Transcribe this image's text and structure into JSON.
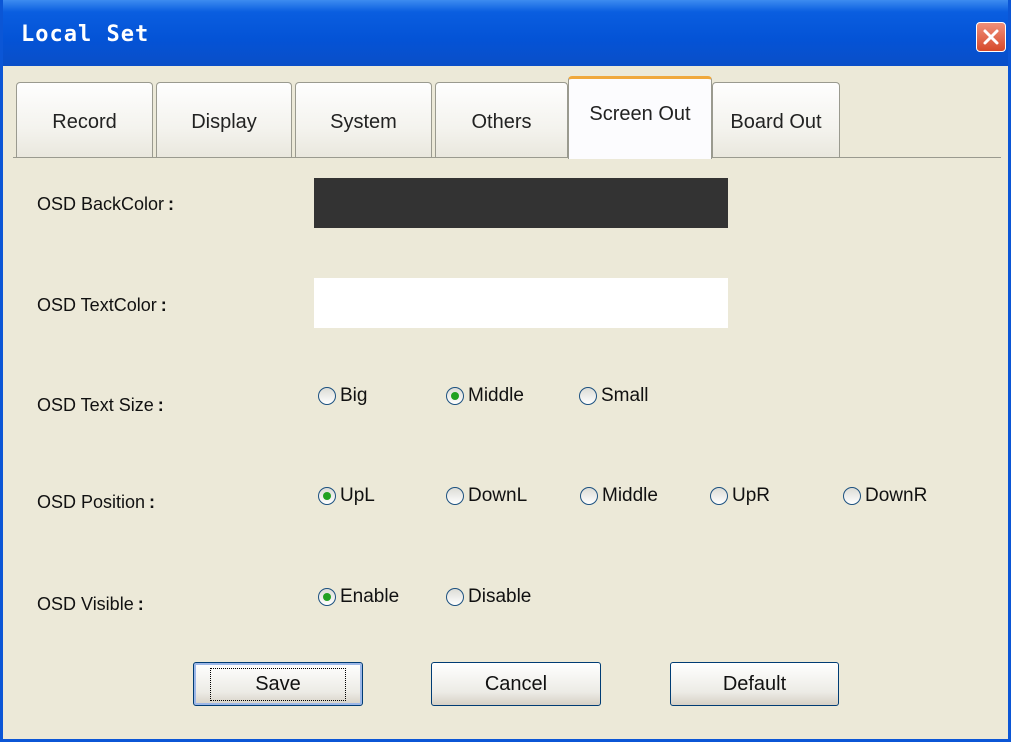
{
  "window": {
    "title": "Local Set"
  },
  "tabs": [
    {
      "label": "Record",
      "active": false
    },
    {
      "label": "Display",
      "active": false
    },
    {
      "label": "System",
      "active": false
    },
    {
      "label": "Others",
      "active": false
    },
    {
      "label": "Screen Out",
      "active": true
    },
    {
      "label": "Board Out",
      "active": false
    }
  ],
  "form": {
    "back_color": {
      "label": "OSD BackColor",
      "value": "#333333"
    },
    "text_color": {
      "label": "OSD TextColor",
      "value": "#ffffff"
    },
    "text_size": {
      "label": "OSD Text Size",
      "options": [
        "Big",
        "Middle",
        "Small"
      ],
      "selected": "Middle"
    },
    "position": {
      "label": "OSD Position",
      "options": [
        "UpL",
        "DownL",
        "Middle",
        "UpR",
        "DownR"
      ],
      "selected": "UpL"
    },
    "visible": {
      "label": "OSD Visible",
      "options": [
        "Enable",
        "Disable"
      ],
      "selected": "Enable"
    },
    "colon": ":"
  },
  "buttons": {
    "save": "Save",
    "cancel": "Cancel",
    "default": "Default"
  },
  "colors": {
    "titlebar": "#0453d6",
    "window_bg": "#ece9d8",
    "active_tab_accent": "#f0a83c",
    "radio_check": "#21a121"
  }
}
